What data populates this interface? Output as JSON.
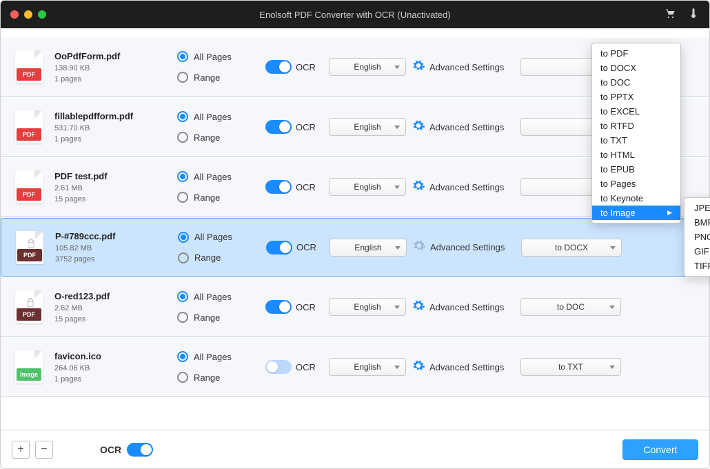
{
  "window": {
    "title": "Enolsoft PDF Converter with OCR (Unactivated)"
  },
  "labels": {
    "all_pages": "All Pages",
    "range": "Range",
    "ocr": "OCR",
    "advanced": "Advanced Settings",
    "footer_ocr": "OCR",
    "convert": "Convert"
  },
  "files": [
    {
      "name": "OoPdfForm.pdf",
      "size": "138.90 KB",
      "pages": "1 pages",
      "icon": "pdf",
      "locked": false,
      "ocr_on": true,
      "lang": "English",
      "format": "",
      "selected": false,
      "show_lock": true
    },
    {
      "name": "fillablepdfform.pdf",
      "size": "531.70 KB",
      "pages": "1 pages",
      "icon": "pdf",
      "locked": false,
      "ocr_on": true,
      "lang": "English",
      "format": "",
      "selected": false,
      "show_lock": true
    },
    {
      "name": "PDF test.pdf",
      "size": "2.61 MB",
      "pages": "15 pages",
      "icon": "pdf",
      "locked": false,
      "ocr_on": true,
      "lang": "English",
      "format": "",
      "selected": false,
      "show_lock": true
    },
    {
      "name": "P-#789ccc.pdf",
      "size": "105.82 MB",
      "pages": "3752 pages",
      "icon": "pdf",
      "locked": true,
      "ocr_on": true,
      "lang": "English",
      "format": "to DOCX",
      "selected": true,
      "show_lock": false
    },
    {
      "name": "O-red123.pdf",
      "size": "2.62 MB",
      "pages": "15 pages",
      "icon": "pdf",
      "locked": true,
      "ocr_on": true,
      "lang": "English",
      "format": "to DOC",
      "selected": false,
      "show_lock": false
    },
    {
      "name": "favicon.ico",
      "size": "264.06 KB",
      "pages": "1 pages",
      "icon": "image",
      "locked": false,
      "ocr_on": false,
      "lang": "English",
      "format": "to TXT",
      "selected": false,
      "show_lock": false
    }
  ],
  "dropdown": {
    "items": [
      "to PDF",
      "to DOCX",
      "to DOC",
      "to PPTX",
      "to EXCEL",
      "to RTFD",
      "to TXT",
      "to HTML",
      "to EPUB",
      "to Pages",
      "to Keynote",
      "to Image"
    ],
    "highlight_index": 11,
    "submenu": [
      "JPEG",
      "BMP",
      "PNG",
      "GIF",
      "TIFF"
    ]
  }
}
